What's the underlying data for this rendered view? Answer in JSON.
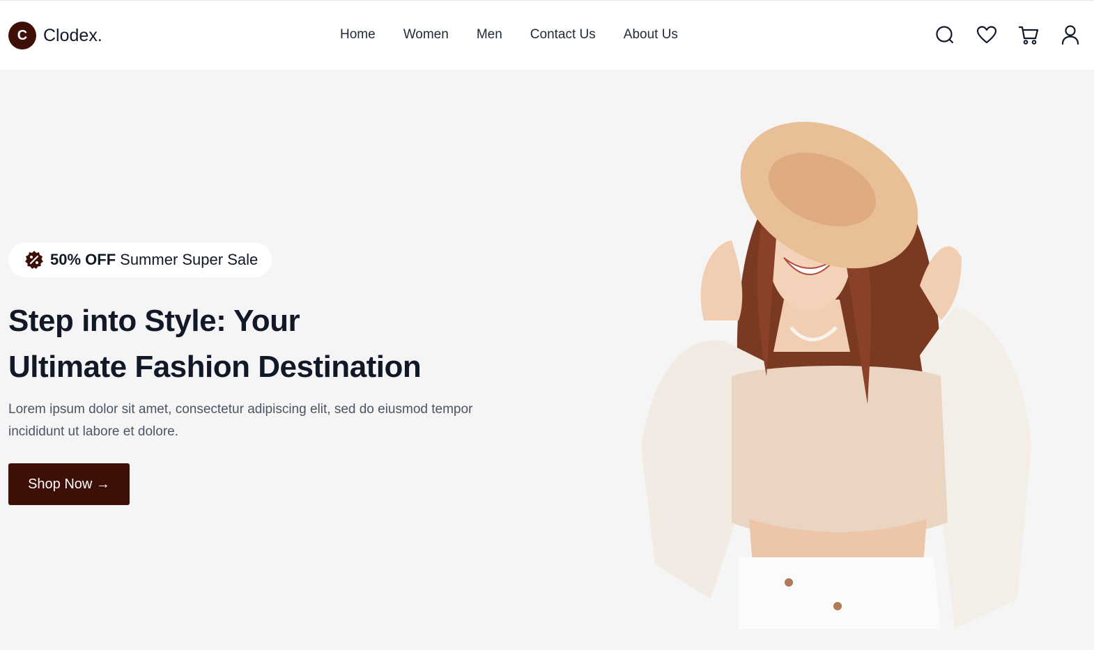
{
  "brand": {
    "logo_letter": "C",
    "name": "Clodex."
  },
  "nav": {
    "links": [
      {
        "label": "Home"
      },
      {
        "label": "Women"
      },
      {
        "label": "Men"
      },
      {
        "label": "Contact Us"
      },
      {
        "label": "About Us"
      }
    ],
    "icons": [
      "search-icon",
      "heart-icon",
      "cart-icon",
      "user-icon"
    ]
  },
  "hero": {
    "badge_bold": "50% OFF",
    "badge_text": "Summer Super Sale",
    "title_line1": "Step into Style: Your",
    "title_line2": "Ultimate Fashion Destination",
    "description": "Lorem ipsum dolor sit amet, consectetur adipiscing elit, sed do eiusmod tempor incididunt ut labore et dolore.",
    "cta_label": "Shop Now →"
  },
  "colors": {
    "brand": "#3d0f06",
    "background": "#f5f5f5",
    "text_dark": "#111827",
    "text_muted": "#4b5563"
  }
}
